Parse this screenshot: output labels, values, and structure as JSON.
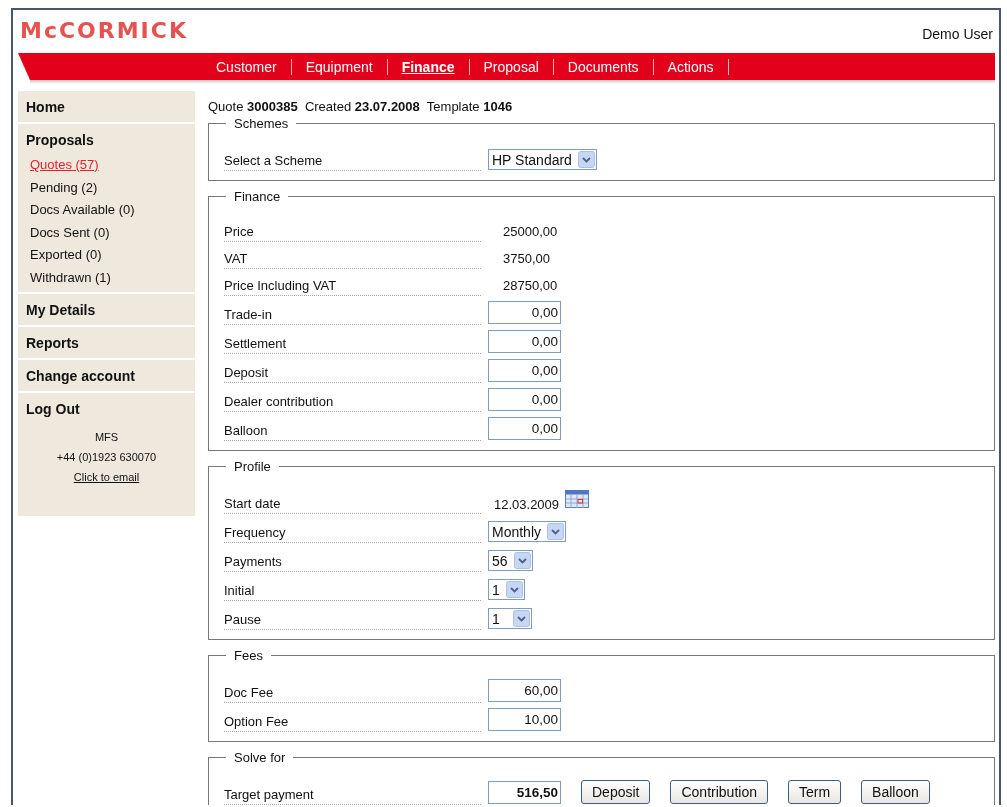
{
  "header": {
    "logo": "McCORMICK",
    "user": "Demo User"
  },
  "nav": [
    {
      "label": "Customer",
      "selected": false
    },
    {
      "label": "Equipment",
      "selected": false
    },
    {
      "label": "Finance",
      "selected": true
    },
    {
      "label": "Proposal",
      "selected": false
    },
    {
      "label": "Documents",
      "selected": false
    },
    {
      "label": "Actions",
      "selected": false
    }
  ],
  "sidebar": {
    "sections": [
      {
        "title": "Home"
      },
      {
        "title": "Proposals",
        "items": [
          {
            "label": "Quotes (57)",
            "selected": true
          },
          {
            "label": "Pending (2)",
            "selected": false
          },
          {
            "label": "Docs Available (0)",
            "selected": false
          },
          {
            "label": "Docs Sent (0)",
            "selected": false
          },
          {
            "label": "Exported (0)",
            "selected": false
          },
          {
            "label": "Withdrawn (1)",
            "selected": false
          }
        ]
      },
      {
        "title": "My Details"
      },
      {
        "title": "Reports"
      },
      {
        "title": "Change account"
      },
      {
        "title": "Log Out"
      }
    ],
    "contact": {
      "name": "MFS",
      "phone": "+44 (0)1923 630070",
      "link": "Click to email"
    }
  },
  "quote_line": "Quote **3000385**  Created **23.07.2008**  Template **1046**",
  "sections": [
    {
      "legend": "Schemes",
      "rows": [
        {
          "kind": "select",
          "label": "Select a Scheme",
          "value": "HP Standard"
        }
      ]
    },
    {
      "legend": "Finance",
      "rows": [
        {
          "kind": "text",
          "label": "Price",
          "value": "25000,00"
        },
        {
          "kind": "text",
          "label": "VAT",
          "value": "3750,00"
        },
        {
          "kind": "text",
          "label": "Price Including VAT",
          "value": "28750,00"
        },
        {
          "kind": "input",
          "label": "Trade-in",
          "value": "0,00",
          "emphasis": false
        },
        {
          "kind": "input",
          "label": "Settlement",
          "value": "0,00",
          "emphasis": false
        },
        {
          "kind": "input",
          "label": "Deposit",
          "value": "0,00",
          "emphasis": false
        },
        {
          "kind": "input",
          "label": "Dealer contribution",
          "value": "0,00",
          "emphasis": false
        },
        {
          "kind": "input",
          "label": "Balloon",
          "value": "0,00",
          "emphasis": false
        }
      ]
    },
    {
      "legend": "Profile",
      "rows": [
        {
          "kind": "date",
          "label": "Start date",
          "value": "12.03.2009"
        },
        {
          "kind": "select",
          "label": "Frequency",
          "value": "Monthly"
        },
        {
          "kind": "select",
          "label": "Payments",
          "value": "56"
        },
        {
          "kind": "select",
          "label": "Initial",
          "value": "1"
        },
        {
          "kind": "select",
          "label": "Pause",
          "value": "1"
        }
      ]
    },
    {
      "legend": "Fees",
      "rows": [
        {
          "kind": "input",
          "label": "Doc Fee",
          "value": "60,00",
          "emphasis": false
        },
        {
          "kind": "input",
          "label": "Option Fee",
          "value": "10,00",
          "emphasis": false
        }
      ]
    },
    {
      "legend": "Solve for",
      "rows": [
        {
          "kind": "input",
          "label": "Target payment",
          "value": "516,50",
          "emphasis": true,
          "buttons": [
            "Deposit",
            "Contribution",
            "Term",
            "Balloon"
          ]
        }
      ]
    }
  ]
}
